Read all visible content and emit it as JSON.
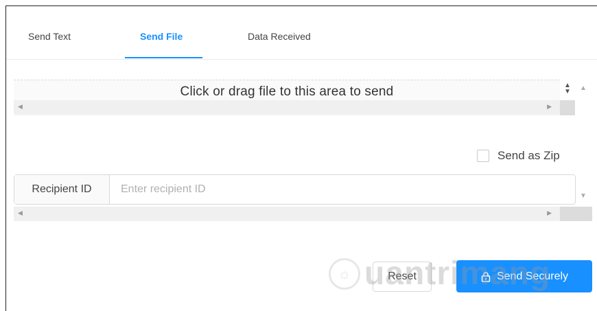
{
  "tabs": [
    {
      "label": "Send Text",
      "active": false
    },
    {
      "label": "Send File",
      "active": true
    },
    {
      "label": "Data Received",
      "active": false
    }
  ],
  "upload": {
    "text": "Click or drag file to this area to send"
  },
  "options": {
    "send_as_zip_label": "Send as Zip",
    "send_as_zip_checked": false
  },
  "recipient": {
    "label": "Recipient ID",
    "value": "",
    "placeholder": "Enter recipient ID"
  },
  "actions": {
    "reset_label": "Reset",
    "send_label": "Send Securely"
  },
  "watermark": {
    "text": "uantrimang"
  },
  "colors": {
    "accent": "#1890ff",
    "border": "#d9d9d9"
  }
}
